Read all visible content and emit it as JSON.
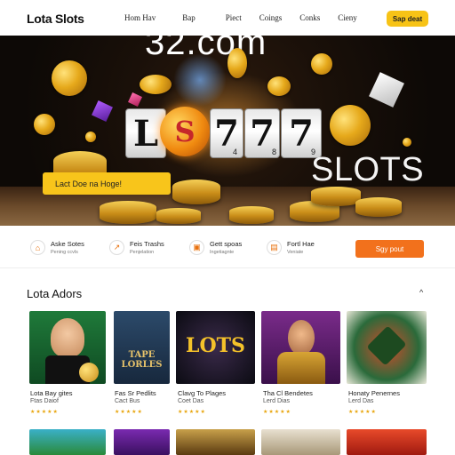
{
  "header": {
    "logo": "Lota Slots",
    "nav": [
      "Hom Hav",
      "Bap",
      "Piect",
      "Coings",
      "Conks",
      "Cieny"
    ],
    "cta": "Sap deat"
  },
  "hero": {
    "domain_text": "32.com",
    "reels": [
      "L",
      "7",
      "7",
      "7"
    ],
    "reel_small": [
      "4",
      "8",
      "9"
    ],
    "coin_symbol": "S",
    "slots_word": "SLOTS",
    "button": "Lact Doe na Hoge!"
  },
  "features": [
    {
      "icon": "home-icon",
      "title": "Aske Sotes",
      "sub": "Pening ccvls"
    },
    {
      "icon": "chart-icon",
      "title": "Feis Trashs",
      "sub": "Penjelation"
    },
    {
      "icon": "gift-icon",
      "title": "Gett spoas",
      "sub": "Ingetiagnte"
    },
    {
      "icon": "document-icon",
      "title": "Fortl Hae",
      "sub": "Veniate"
    }
  ],
  "signup_button": "Sgy pout",
  "section": {
    "title": "Lota Adors",
    "arrow": "^"
  },
  "games": [
    {
      "caption": "Lota Bay gites",
      "sub": "Ftas Daiof",
      "stars": "★★★★★",
      "tile_text": ""
    },
    {
      "caption": "Fas Sr Pedlits",
      "sub": "Cact Bus",
      "stars": "★★★★★",
      "tile_text": "TAPE LORLES"
    },
    {
      "caption": "Clavg To Plages",
      "sub": "Coet Das",
      "stars": "★★★★★",
      "tile_text": "LOTS"
    },
    {
      "caption": "Tha Cl Bendetes",
      "sub": "Lerd Dias",
      "stars": "★★★★★",
      "tile_text": ""
    },
    {
      "caption": "Honaty Penernes",
      "sub": "Lerd Das",
      "stars": "★★★★★",
      "tile_text": ""
    }
  ],
  "colors": {
    "accent_yellow": "#f7c316",
    "accent_orange": "#f2711c",
    "star": "#e8a60e"
  }
}
